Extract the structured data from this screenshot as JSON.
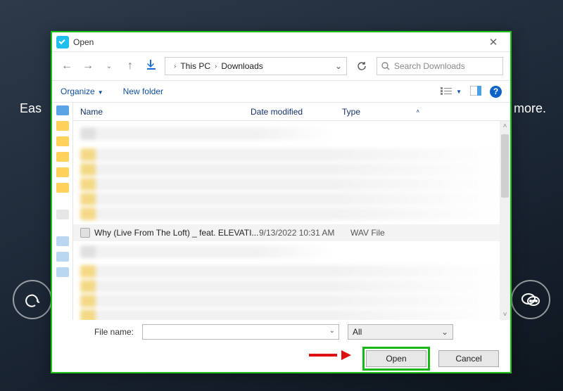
{
  "backdrop": {
    "left_text": "Eas",
    "right_text": "more."
  },
  "titlebar": {
    "title": "Open"
  },
  "nav": {
    "crumb1": "This PC",
    "crumb2": "Downloads",
    "search_placeholder": "Search Downloads"
  },
  "toolbar": {
    "organize": "Organize",
    "newfolder": "New folder"
  },
  "columns": {
    "name": "Name",
    "date": "Date modified",
    "type": "Type"
  },
  "selected": {
    "name": "Why (Live From The Loft) _ feat. ELEVATI...",
    "date": "9/13/2022 10:31 AM",
    "type": "WAV File"
  },
  "bottom": {
    "filename_label": "File name:",
    "filename_value": "",
    "filter": "All",
    "open": "Open",
    "cancel": "Cancel"
  }
}
